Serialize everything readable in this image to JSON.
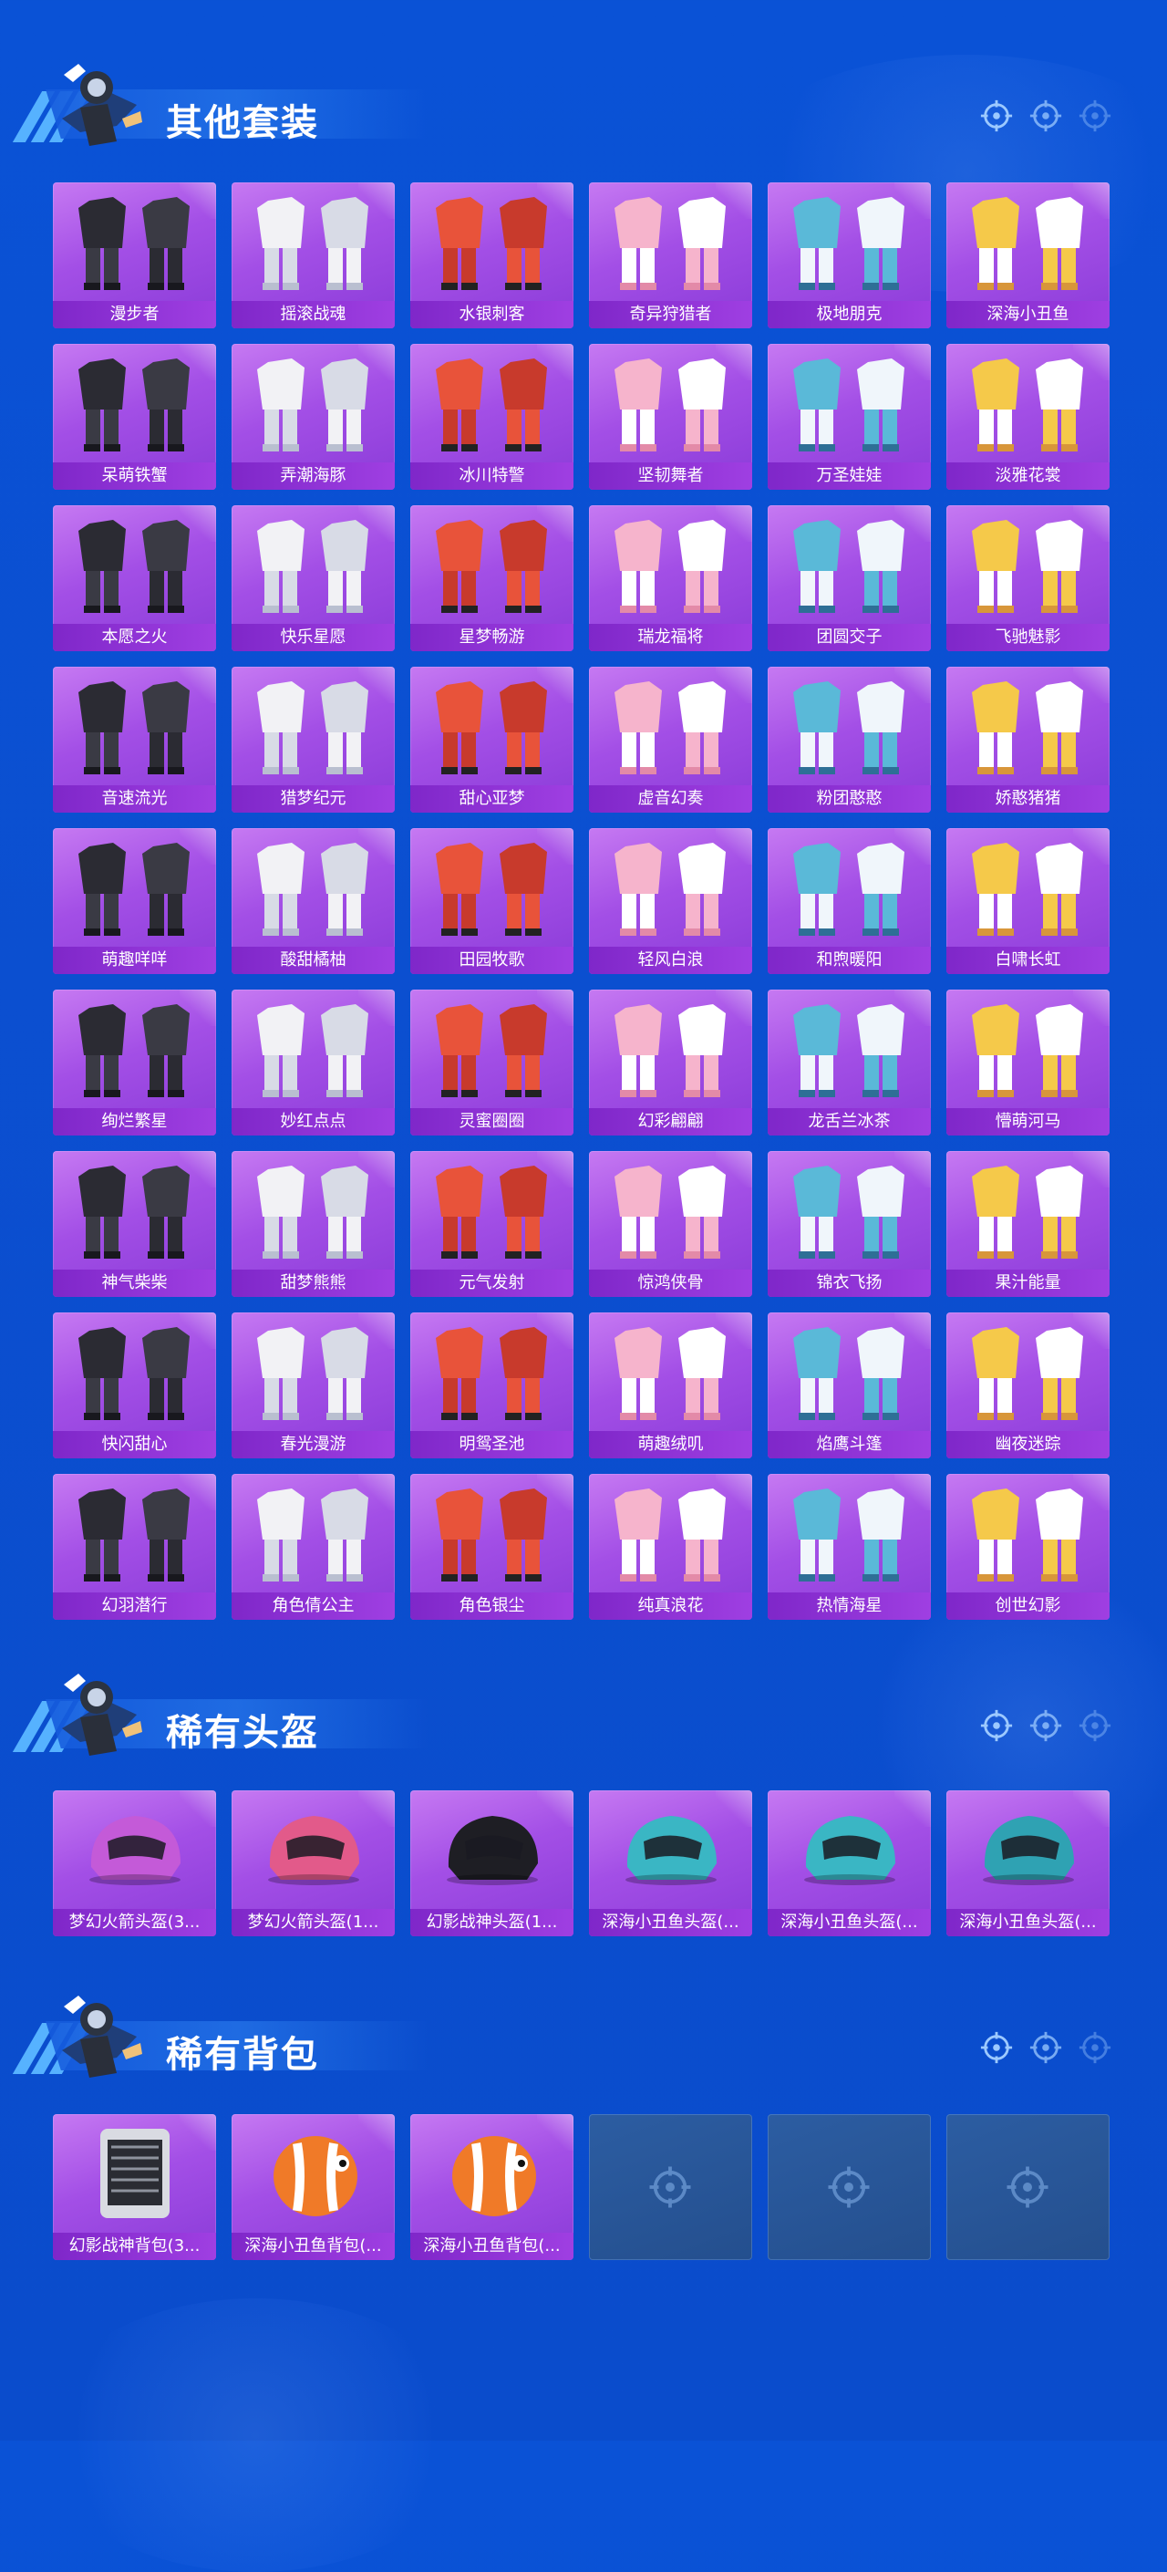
{
  "colors": {
    "background": "#0b4fd0",
    "card_purple": "#a34fe6",
    "label_bar": "#8a30d4",
    "empty_slot": "#2a5799"
  },
  "sections": [
    {
      "title": "其他套装",
      "items": [
        "漫步者",
        "摇滚战魂",
        "水银刺客",
        "奇异狩猎者",
        "极地朋克",
        "深海小丑鱼",
        "呆萌铁蟹",
        "弄潮海豚",
        "冰川特警",
        "坚韧舞者",
        "万圣娃娃",
        "淡雅花裳",
        "本愿之火",
        "快乐星愿",
        "星梦畅游",
        "瑞龙福将",
        "团圆交子",
        "飞驰魅影",
        "音速流光",
        "猎梦纪元",
        "甜心亚梦",
        "虚音幻奏",
        "粉团憨憨",
        "娇憨猪猪",
        "萌趣咩咩",
        "酸甜橘柚",
        "田园牧歌",
        "轻风白浪",
        "和煦暖阳",
        "白啸长虹",
        "绚烂繁星",
        "妙红点点",
        "灵蜜圈圈",
        "幻彩翩翩",
        "龙舌兰冰茶",
        "懵萌河马",
        "神气柴柴",
        "甜梦熊熊",
        "元气发射",
        "惊鸿侠骨",
        "锦衣飞扬",
        "果汁能量",
        "快闪甜心",
        "春光漫游",
        "明鸳圣池",
        "萌趣绒叽",
        "焰鹰斗篷",
        "幽夜迷踪",
        "幻羽潜行",
        "角色倩公主",
        "角色银尘",
        "纯真浪花",
        "热情海星",
        "创世幻影"
      ]
    },
    {
      "title": "稀有头盔",
      "items": [
        "梦幻火箭头盔(3...",
        "梦幻火箭头盔(1...",
        "幻影战神头盔(1...",
        "深海小丑鱼头盔(...",
        "深海小丑鱼头盔(...",
        "深海小丑鱼头盔(..."
      ]
    },
    {
      "title": "稀有背包",
      "items": [
        "幻影战神背包(3...",
        "深海小丑鱼背包(...",
        "深海小丑鱼背包(..."
      ],
      "empty_slots": 3
    }
  ]
}
